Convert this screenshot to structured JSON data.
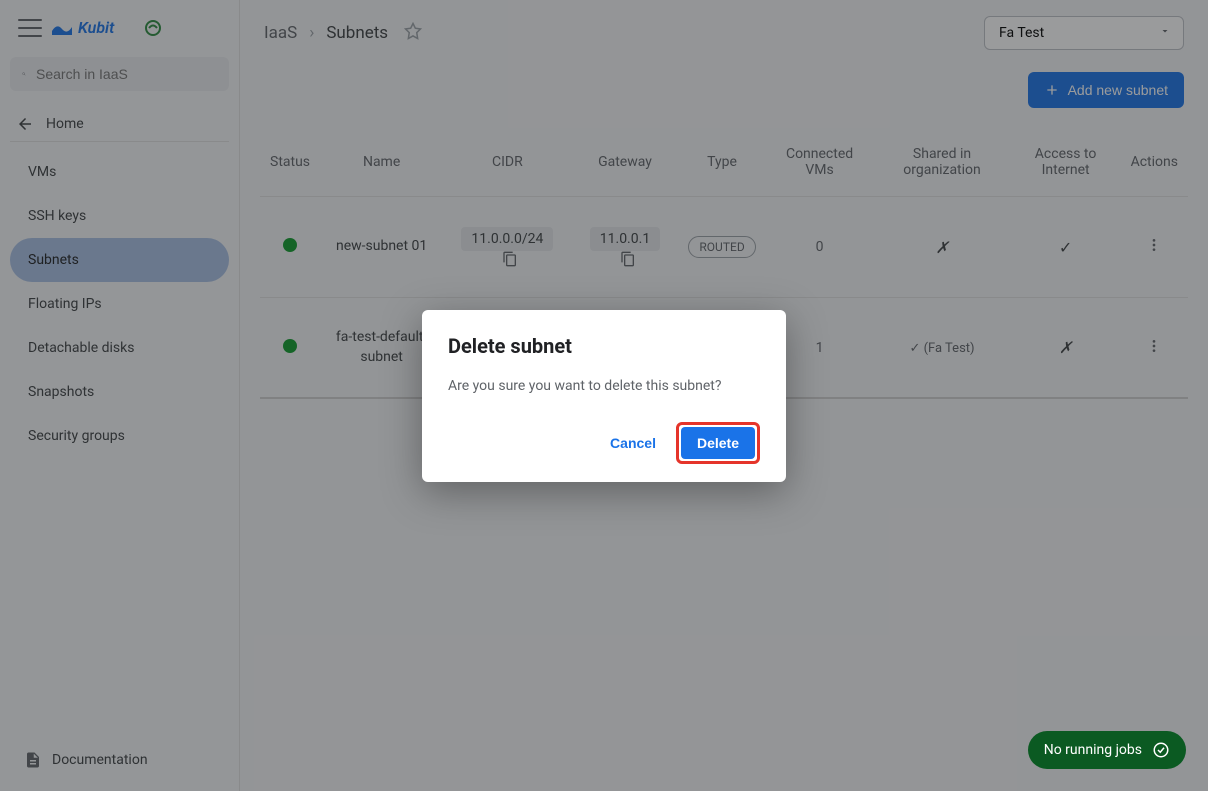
{
  "brand": {
    "name": "Kubit"
  },
  "search": {
    "placeholder": "Search in IaaS"
  },
  "home_label": "Home",
  "nav": {
    "items": [
      {
        "label": "VMs"
      },
      {
        "label": "SSH keys"
      },
      {
        "label": "Subnets",
        "active": true
      },
      {
        "label": "Floating IPs"
      },
      {
        "label": "Detachable disks"
      },
      {
        "label": "Snapshots"
      },
      {
        "label": "Security groups"
      }
    ]
  },
  "documentation_label": "Documentation",
  "breadcrumb": {
    "root": "IaaS",
    "current": "Subnets"
  },
  "project_selector": {
    "value": "Fa Test"
  },
  "add_button_label": "Add new subnet",
  "columns": {
    "status": "Status",
    "name": "Name",
    "cidr": "CIDR",
    "gateway": "Gateway",
    "type": "Type",
    "connected": "Connected VMs",
    "shared": "Shared in organization",
    "internet": "Access to Internet",
    "actions": "Actions"
  },
  "rows": [
    {
      "status": "up",
      "name": "new-subnet 01",
      "cidr": "11.0.0.0/24",
      "gateway": "11.0.0.1",
      "type": "ROUTED",
      "connected": "0",
      "shared": "✗",
      "internet": "✓"
    },
    {
      "status": "up",
      "name": "fa-test-default-subnet",
      "cidr": "",
      "gateway": "",
      "type": "",
      "connected": "1",
      "shared": "✓ (Fa Test)",
      "internet": "✗"
    }
  ],
  "dialog": {
    "title": "Delete subnet",
    "message": "Are you sure you want to delete this subnet?",
    "cancel": "Cancel",
    "confirm": "Delete"
  },
  "jobs_pill": "No running jobs"
}
